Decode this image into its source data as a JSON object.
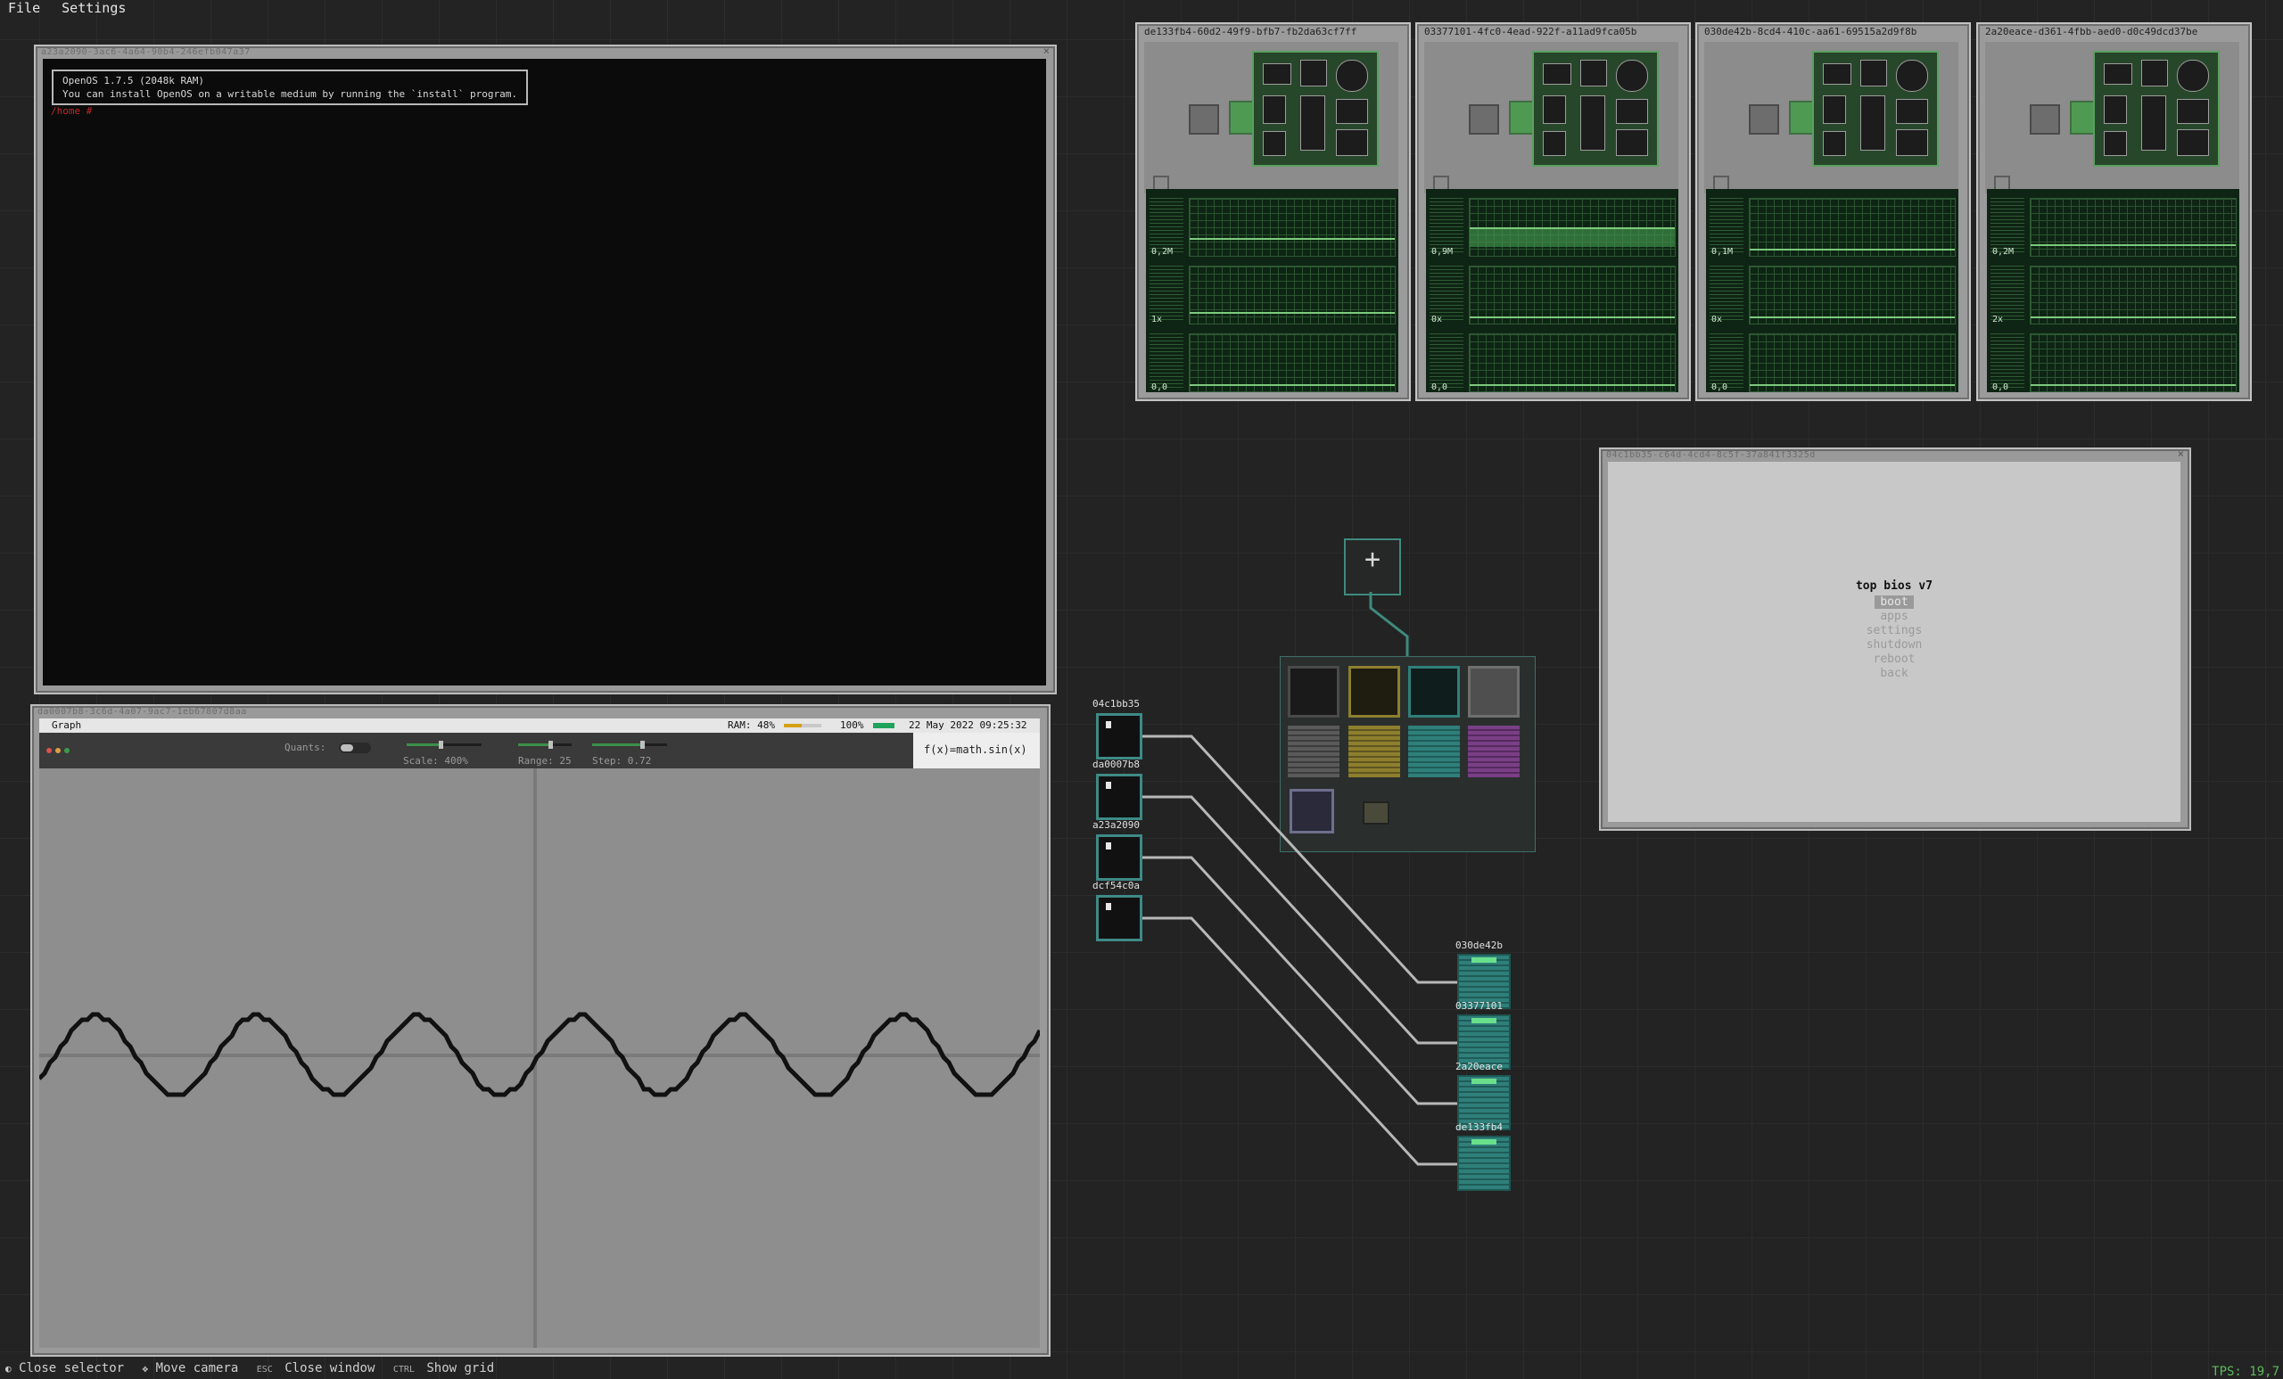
{
  "menu": {
    "file": "File",
    "settings": "Settings"
  },
  "terminal_window": {
    "title": "a23a2090-3ac6-4a64-90b4-246efb047a37",
    "motd_line1": "OpenOS 1.7.5 (2048k RAM)",
    "motd_line2": "You can install OpenOS on a writable medium by running the `install` program.",
    "prompt": "/home #"
  },
  "graph_window": {
    "title": "da0007b8-3c6d-4a07-9ac7-1eb67807d8aa",
    "app_name": "Graph",
    "ram": "RAM: 48%",
    "battery": "100%",
    "datetime": "22 May 2022 09:25:32",
    "quants_label": "Quants:",
    "scale_label": "Scale: 400%",
    "range_label": "Range: 25",
    "step_label": "Step: 0.72",
    "formula": "f(x)=math.sin(x)",
    "chart_data": {
      "type": "line",
      "function": "f(x)=math.sin(x)",
      "scale_percent": 400,
      "range": 25,
      "step": 0.72,
      "series": [
        {
          "name": "f(x)=math.sin(x)",
          "x_range": [
            -25,
            25
          ]
        }
      ]
    }
  },
  "racks": [
    {
      "title": "de133fb4-60d2-49f9-bfb7-fb2da63cf7ff",
      "vals": [
        "0,2M",
        "1x",
        "0,0"
      ],
      "levels": [
        0.25,
        0.1,
        0.0
      ]
    },
    {
      "title": "03377101-4fc0-4ead-922f-a11ad9fca05b",
      "vals": [
        "0,9M",
        "0x",
        "0,0"
      ],
      "levels": [
        0.5,
        0.0,
        0.0
      ]
    },
    {
      "title": "030de42b-8cd4-410c-aa61-69515a2d9f8b",
      "vals": [
        "0,1M",
        "0x",
        "0,0"
      ],
      "levels": [
        0.0,
        0.0,
        0.0
      ]
    },
    {
      "title": "2a20eace-d361-4fbb-aed0-d0c49dcd37be",
      "vals": [
        "0,2M",
        "2x",
        "0,0"
      ],
      "levels": [
        0.1,
        0.0,
        0.0
      ]
    }
  ],
  "bios_window": {
    "title": "04c1bb35-c64d-4cd4-8c5f-37a841f3325d",
    "heading": "top bios v7",
    "items": [
      "boot",
      "apps",
      "settings",
      "shutdown",
      "reboot",
      "back"
    ]
  },
  "palette": {
    "add_symbol": "+"
  },
  "screens": [
    "04c1bb35",
    "da0007b8",
    "a23a2090",
    "dcf54c0a"
  ],
  "servers": [
    "030de42b",
    "03377101",
    "2a20eace",
    "de133fb4"
  ],
  "footer": {
    "k1_label": "Close selector",
    "k2_label": "Move camera",
    "k3_key": "ESC",
    "k3_label": "Close window",
    "k4_key": "CTRL",
    "k4_label": "Show grid",
    "tps": "TPS: 19,7"
  }
}
